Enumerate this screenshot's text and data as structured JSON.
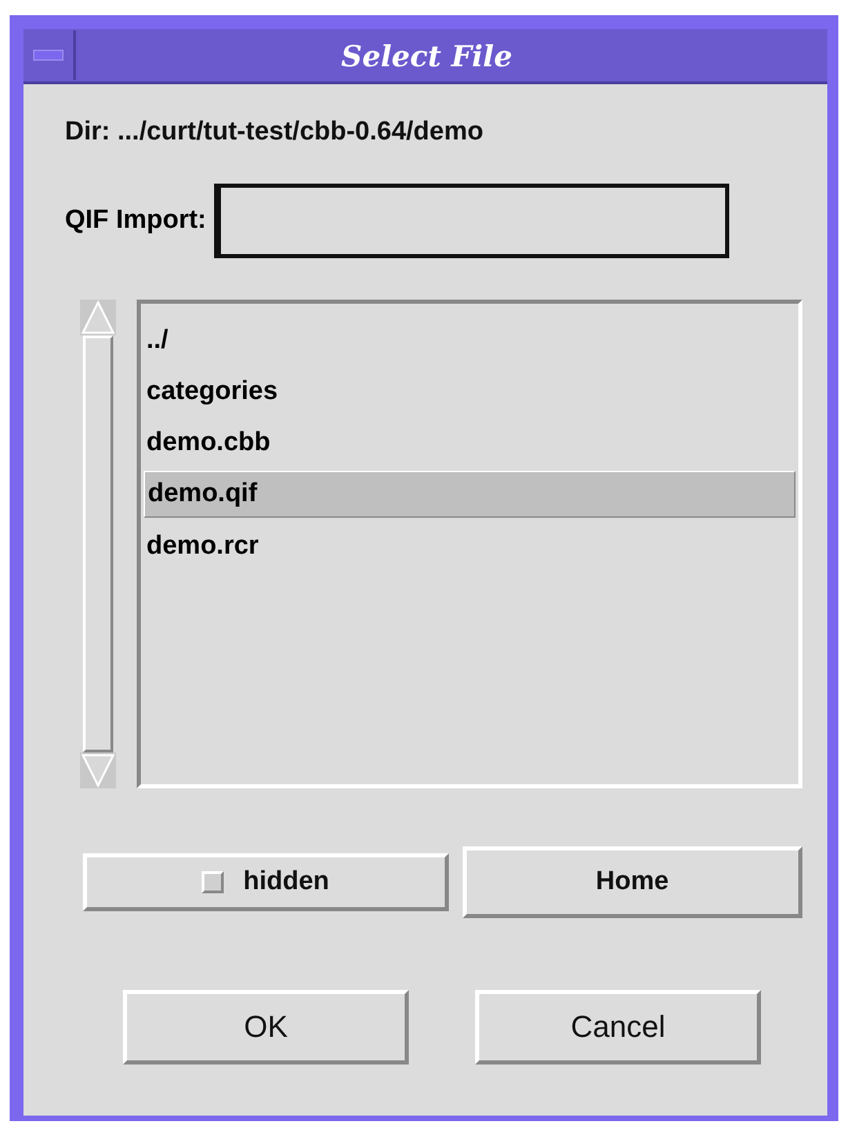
{
  "window": {
    "title": "Select File"
  },
  "directory": "Dir: .../curt/tut-test/cbb-0.64/demo",
  "qif_import": {
    "label": "QIF Import:"
  },
  "files": [
    {
      "name": "../",
      "selected": false
    },
    {
      "name": "categories",
      "selected": false
    },
    {
      "name": "demo.cbb",
      "selected": false
    },
    {
      "name": "demo.qif",
      "selected": true
    },
    {
      "name": "demo.rcr",
      "selected": false
    }
  ],
  "hidden_toggle": {
    "label": "hidden",
    "checked": false
  },
  "home_button": "Home",
  "buttons": [
    "OK",
    "Cancel"
  ]
}
